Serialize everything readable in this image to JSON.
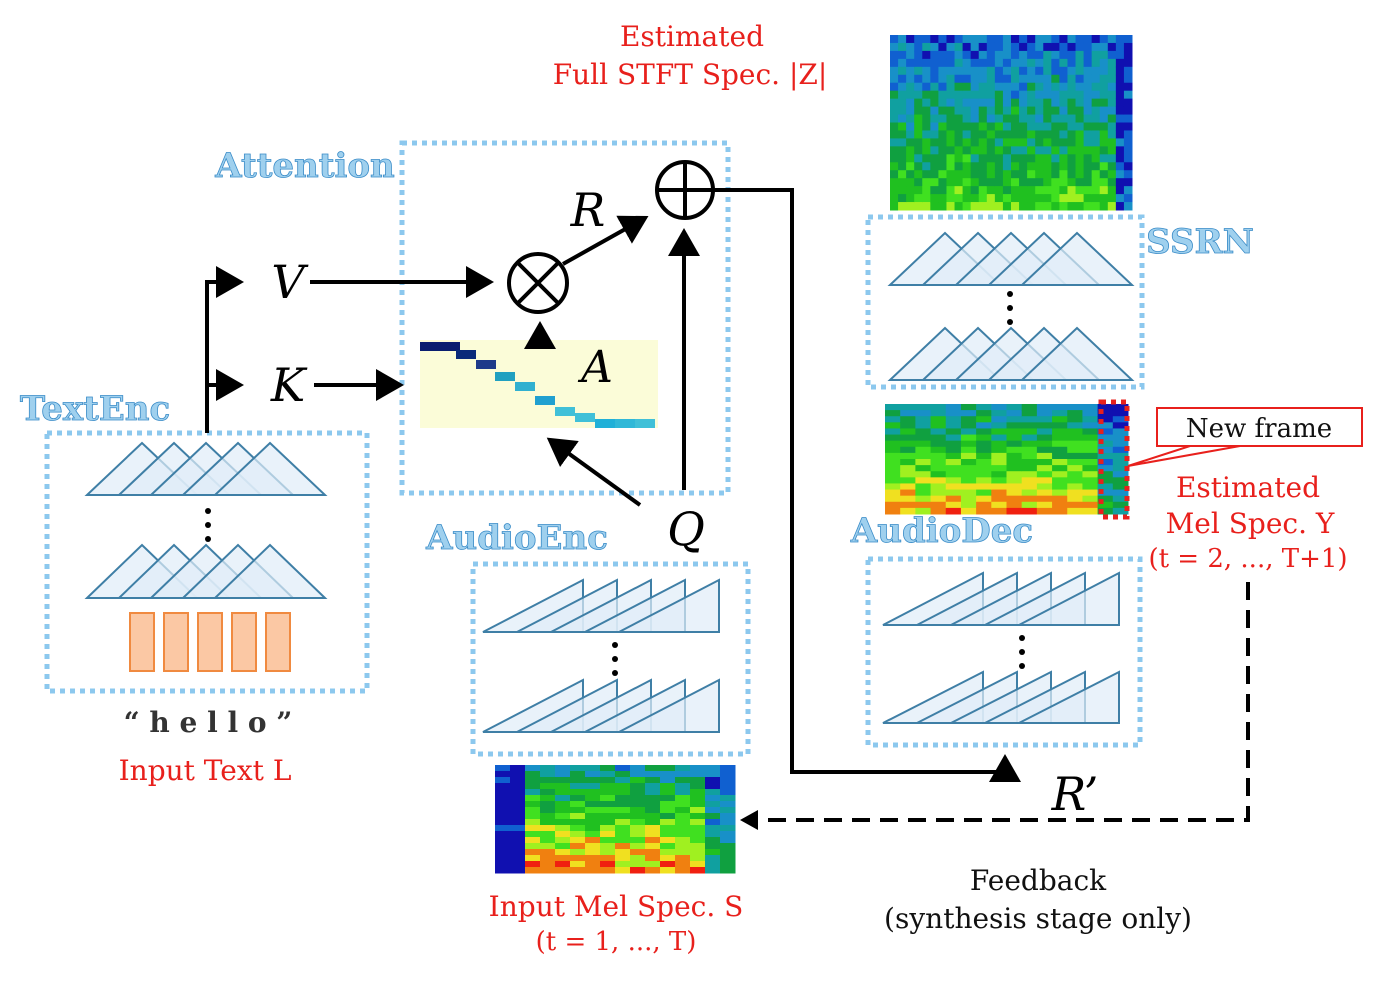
{
  "labels": {
    "stft_line1": "Estimated",
    "stft_line2": "Full STFT Spec. |Z|",
    "attention": "Attention",
    "textenc": "TextEnc",
    "audioenc": "AudioEnc",
    "audiodec": "AudioDec",
    "ssrn": "SSRN",
    "v": "V",
    "k": "K",
    "q": "Q",
    "r": "R",
    "a": "A",
    "r_prime": "R’",
    "hello": "“ h e l l o ”",
    "input_text": "Input Text L",
    "input_mel_line1": "Input Mel Spec. S",
    "input_mel_line2": "(t = 1, ..., T)",
    "new_frame": "New frame",
    "est_mel_line1": "Estimated",
    "est_mel_line2": "Mel Spec. Y",
    "est_mel_line3": "(t = 2, ..., T+1)",
    "feedback_line1": "Feedback",
    "feedback_line2": "(synthesis stage only)"
  },
  "colors": {
    "module_label": "#9fd0ee",
    "annotation": "#e8201c",
    "dotted_box": "#8cc8ee",
    "embedding": "#fbc8a4"
  },
  "icons": [
    "otimes-icon",
    "oplus-icon"
  ]
}
